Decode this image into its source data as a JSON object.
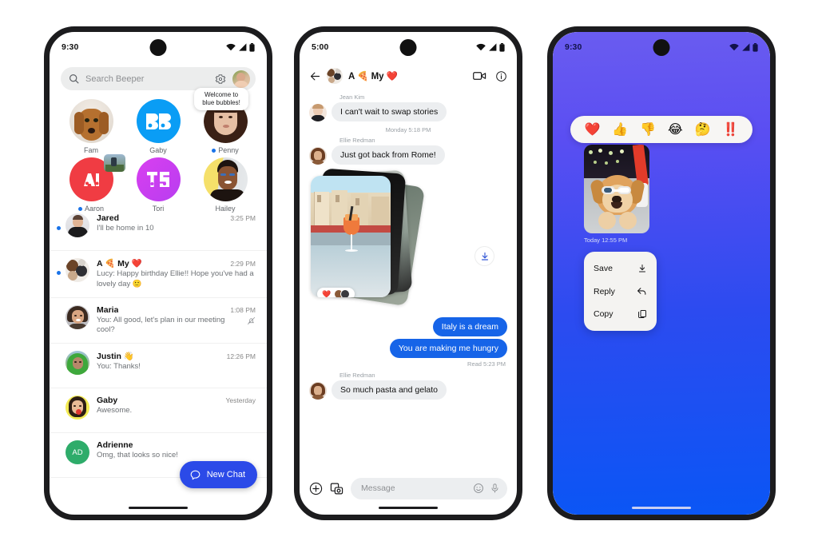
{
  "phone1": {
    "status": {
      "time": "9:30",
      "icons": [
        "wifi-icon",
        "signal-icon",
        "battery-icon"
      ]
    },
    "search": {
      "placeholder": "Search Beeper",
      "icon": "search-icon",
      "settings_icon": "gear-icon",
      "avatar": "profile-avatar"
    },
    "pinned": [
      {
        "name": "Fam",
        "unread": false,
        "avatar": "dog-avatar"
      },
      {
        "name": "Gaby",
        "unread": false,
        "avatar": "beeper-logo-avatar"
      },
      {
        "name": "Penny",
        "unread": true,
        "avatar": "penny-avatar",
        "tooltip": "Welcome to blue bubbles!"
      },
      {
        "name": "Aaron",
        "unread": true,
        "avatar": "aaron-avatar"
      },
      {
        "name": "Tori",
        "unread": false,
        "avatar": "tori-avatar"
      },
      {
        "name": "Hailey",
        "unread": false,
        "avatar": "hailey-avatar"
      }
    ],
    "chats": [
      {
        "name": "Jared",
        "time": "3:25 PM",
        "preview": "I'll be home in 10",
        "unread": true,
        "muted": false
      },
      {
        "name": "A 🍕 My ❤️",
        "time": "2:29 PM",
        "preview": "Lucy: Happy birthday Ellie!! Hope you've had a lovely day  🙂",
        "unread": true,
        "muted": false
      },
      {
        "name": "Maria",
        "time": "1:08 PM",
        "preview": "You: All good, let's plan in our meeting cool?",
        "unread": false,
        "muted": true
      },
      {
        "name": "Justin 👋",
        "time": "12:26 PM",
        "preview": "You: Thanks!",
        "unread": false,
        "muted": false
      },
      {
        "name": "Gaby",
        "time": "Yesterday",
        "preview": "Awesome.",
        "unread": false,
        "muted": false
      },
      {
        "name": "Adrienne",
        "time": "",
        "preview": "Omg, that looks so nice!",
        "unread": false,
        "muted": false,
        "initials": "AD"
      }
    ],
    "fab": {
      "label": "New Chat",
      "icon": "chat-bubble-icon",
      "color": "#2b4ae8"
    }
  },
  "phone2": {
    "status": {
      "time": "5:00"
    },
    "header": {
      "back_icon": "back-arrow-icon",
      "title": "A 🍕 My ❤️",
      "video_icon": "video-call-icon",
      "info_icon": "info-icon",
      "avatar": "group-avatar"
    },
    "messages": [
      {
        "type": "incoming",
        "sender": "Jean Kim",
        "text": "I can't wait to swap stories"
      },
      {
        "type": "daystamp",
        "text": "Monday 5:18 PM"
      },
      {
        "type": "incoming",
        "sender": "Ellie Redman",
        "text": "Just got back from Rome!"
      },
      {
        "type": "photo-stack",
        "reaction": "❤️",
        "reactors": "2-avatars",
        "download_icon": "download-icon"
      },
      {
        "type": "outgoing",
        "text": "Italy is a dream"
      },
      {
        "type": "outgoing",
        "text": "You are making me hungry"
      },
      {
        "type": "readstamp",
        "text": "Read  5:23 PM"
      },
      {
        "type": "incoming",
        "sender": "Ellie Redman",
        "text": "So much pasta and gelato"
      }
    ],
    "composer": {
      "plus_icon": "plus-icon",
      "camera_icon": "camera-gallery-icon",
      "placeholder": "Message",
      "emoji_icon": "emoji-icon",
      "mic_icon": "microphone-icon"
    }
  },
  "phone3": {
    "status": {
      "time": "9:30"
    },
    "reactions": [
      "❤️",
      "👍",
      "👎",
      "😂",
      "🤔",
      "‼️"
    ],
    "photo": "dog-sunglasses-photo",
    "timestamp": "Today  12:55 PM",
    "menu": [
      {
        "label": "Save",
        "icon": "download-icon"
      },
      {
        "label": "Reply",
        "icon": "reply-arrow-icon"
      },
      {
        "label": "Copy",
        "icon": "copy-icon"
      }
    ],
    "background_top": "#6a5cf0",
    "background_bottom": "#0a56f5"
  }
}
